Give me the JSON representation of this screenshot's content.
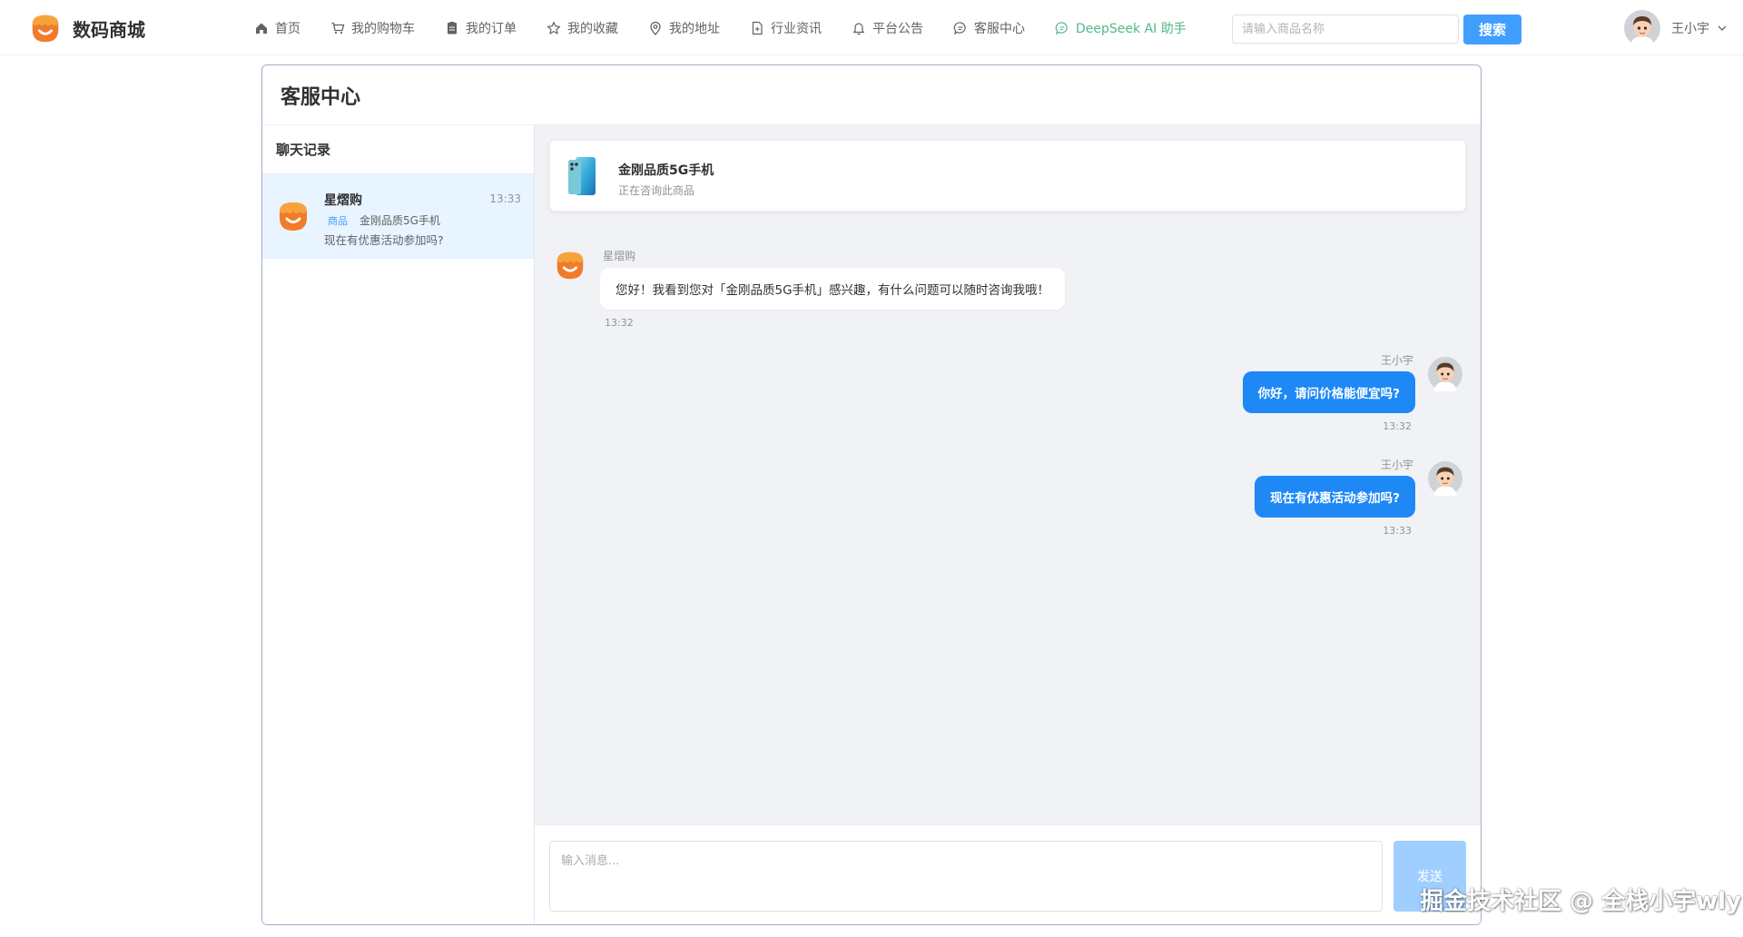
{
  "brand": {
    "name": "数码商城"
  },
  "nav": {
    "items": [
      {
        "label": "首页",
        "icon": "home-icon"
      },
      {
        "label": "我的购物车",
        "icon": "cart-icon"
      },
      {
        "label": "我的订单",
        "icon": "order-icon"
      },
      {
        "label": "我的收藏",
        "icon": "star-icon"
      },
      {
        "label": "我的地址",
        "icon": "location-icon"
      },
      {
        "label": "行业资讯",
        "icon": "document-icon"
      },
      {
        "label": "平台公告",
        "icon": "bell-icon"
      },
      {
        "label": "客服中心",
        "icon": "chat-icon"
      },
      {
        "label": "DeepSeek AI 助手",
        "icon": "chat-icon"
      }
    ],
    "ai_color": "#52b788"
  },
  "search": {
    "placeholder": "请输入商品名称",
    "value": "",
    "button_label": "搜索"
  },
  "user": {
    "name": "王小宇"
  },
  "page": {
    "title": "客服中心"
  },
  "sidebar": {
    "title": "聊天记录",
    "sessions": [
      {
        "name": "星熠购",
        "time": "13:33",
        "tag": "商品",
        "product": "金刚品质5G手机",
        "last_message": "现在有优惠活动参加吗?"
      }
    ]
  },
  "product_card": {
    "name": "金刚品质5G手机",
    "subtitle": "正在咨询此商品"
  },
  "messages": [
    {
      "side": "left",
      "sender": "星熠购",
      "text": "您好！我看到您对「金刚品质5G手机」感兴趣，有什么问题可以随时咨询我哦！",
      "time": "13:32"
    },
    {
      "side": "right",
      "sender": "王小宇",
      "text": "你好，请问价格能便宜吗?",
      "time": "13:32"
    },
    {
      "side": "right",
      "sender": "王小宇",
      "text": "现在有优惠活动参加吗?",
      "time": "13:33"
    }
  ],
  "composer": {
    "placeholder": "输入消息...",
    "value": "",
    "send_label": "发送"
  },
  "watermark": "掘金技术社区 @ 全栈小宇wly",
  "colors": {
    "primary": "#409eff",
    "bubble_self": "#1e88f5",
    "send_disabled": "#a0cfff",
    "chat_bg": "#f0f2f5",
    "session_active": "#e8f4ff"
  }
}
